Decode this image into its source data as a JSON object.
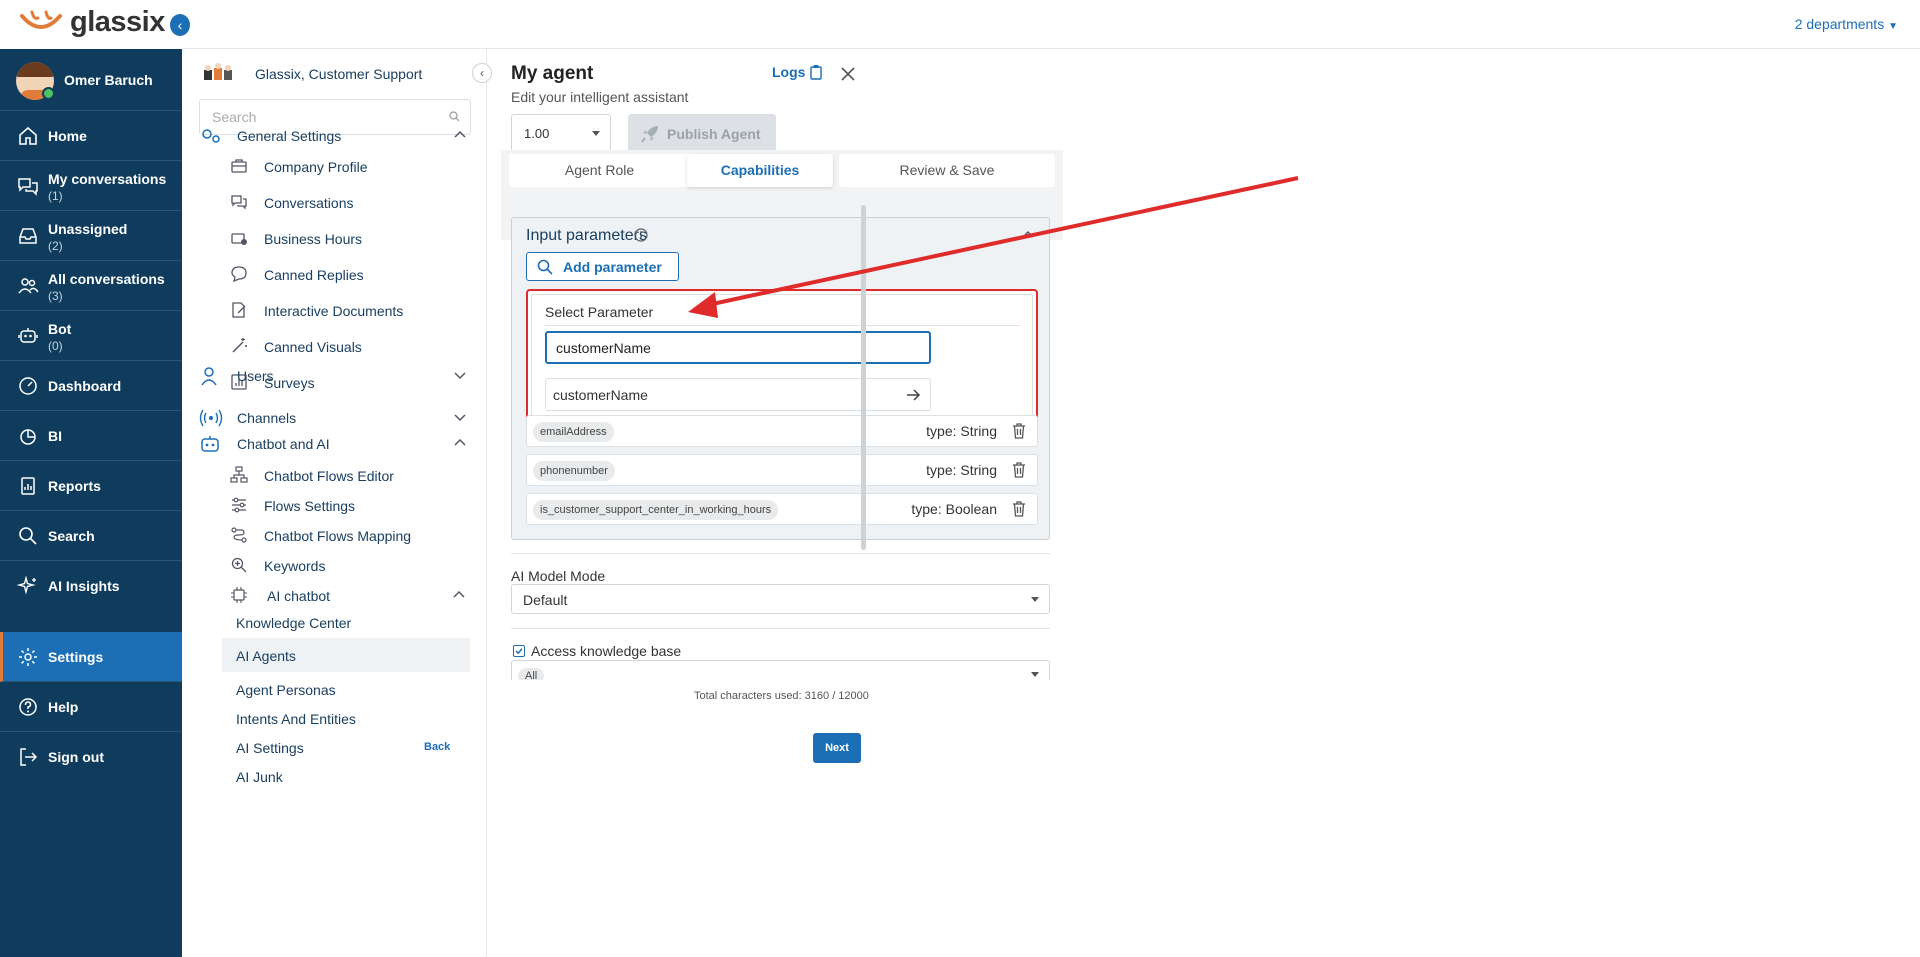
{
  "brand": {
    "name": "glassix"
  },
  "topbar": {
    "departments": "2 departments"
  },
  "user": {
    "name": "Omer Baruch"
  },
  "nav": {
    "home": "Home",
    "my_conversations": "My conversations",
    "my_conversations_count": "(1)",
    "unassigned": "Unassigned",
    "unassigned_count": "(2)",
    "all_conversations": "All conversations",
    "all_conversations_count": "(3)",
    "bot": "Bot",
    "bot_count": "(0)",
    "dashboard": "Dashboard",
    "bi": "BI",
    "reports": "Reports",
    "search": "Search",
    "ai_insights": "AI Insights",
    "settings": "Settings",
    "help": "Help",
    "sign_out": "Sign out"
  },
  "settings_sidebar": {
    "org": "Glassix, Customer Support",
    "search_placeholder": "Search",
    "general_settings": "General Settings",
    "company_profile": "Company Profile",
    "conversations": "Conversations",
    "business_hours": "Business Hours",
    "canned_replies": "Canned Replies",
    "interactive_documents": "Interactive Documents",
    "canned_visuals": "Canned Visuals",
    "surveys": "Surveys",
    "users": "Users",
    "channels": "Channels",
    "chatbot_and_ai": "Chatbot and AI",
    "chatbot_flows_editor": "Chatbot Flows Editor",
    "flows_settings": "Flows Settings",
    "chatbot_flows_mapping": "Chatbot Flows Mapping",
    "keywords": "Keywords",
    "ai_chatbot": "AI chatbot",
    "knowledge_center": "Knowledge Center",
    "ai_agents": "AI Agents",
    "agent_personas": "Agent Personas",
    "intents_and_entities": "Intents And Entities",
    "ai_settings": "AI Settings",
    "ai_junk": "AI Junk"
  },
  "agent": {
    "title": "My agent",
    "subtitle": "Edit your intelligent assistant",
    "logs": "Logs",
    "version": "1.00",
    "publish": "Publish Agent",
    "tabs": [
      "Agent Role",
      "Capabilities",
      "Review & Save"
    ],
    "active_tab": "Capabilities",
    "input_parameters": "Input parameters",
    "add_parameter": "Add parameter",
    "select_parameter": "Select Parameter",
    "param_input_value": "customerName",
    "suggestion": "customerName",
    "params": [
      {
        "name": "emailAddress",
        "type": "type: String"
      },
      {
        "name": "phonenumber",
        "type": "type: String"
      },
      {
        "name": "is_customer_support_center_in_working_hours",
        "type": "type: Boolean"
      }
    ],
    "ai_model_mode_label": "AI Model Mode",
    "ai_model_mode_value": "Default",
    "access_kb_label": "Access knowledge base",
    "kb_value": "All",
    "total_chars": "Total characters used: 3160 / 12000",
    "back": "Back",
    "next": "Next"
  },
  "colors": {
    "nav_bg": "#0f3c5c",
    "accent": "#1c6fb5",
    "highlight_red": "#e02b2b",
    "active_marker": "#e07b39"
  }
}
